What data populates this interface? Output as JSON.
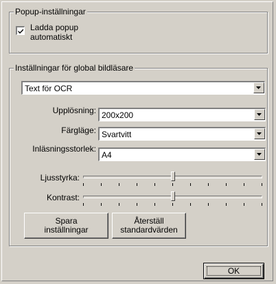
{
  "popup_group": {
    "title": "Popup-inställningar",
    "autoload": {
      "label_line1": "Ladda popup",
      "label_line2": "automatiskt",
      "checked": true
    }
  },
  "scanner_group": {
    "title": "Inställningar för global bildläsare",
    "profile": {
      "value": "Text för OCR"
    },
    "resolution": {
      "label": "Upplösning:",
      "value": "200x200"
    },
    "color_mode": {
      "label": "Färgläge:",
      "value": "Svartvitt"
    },
    "scan_size": {
      "label": "Inläsningsstorlek:",
      "value": "A4"
    },
    "brightness": {
      "label": "Ljusstyrka:",
      "level_fraction": 0.5,
      "ticks": 11
    },
    "contrast": {
      "label": "Kontrast:",
      "level_fraction": 0.5,
      "ticks": 11
    },
    "save_button": {
      "line1": "Spara",
      "line2": "inställningar"
    },
    "reset_button": {
      "line1": "Återställ",
      "line2": "standardvärden"
    }
  },
  "ok_button": {
    "label": "OK"
  }
}
